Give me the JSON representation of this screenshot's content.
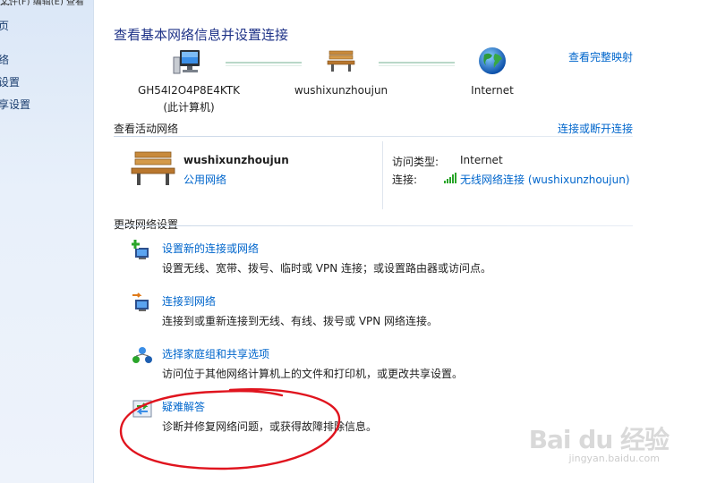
{
  "sidebar": {
    "top_text": "文件(F) 编辑(E) 查看(V)",
    "items": [
      {
        "label": "页"
      },
      {
        "label": "络"
      },
      {
        "label": "设置"
      },
      {
        "label": "享设置"
      }
    ]
  },
  "page": {
    "title": "查看基本网络信息并设置连接",
    "full_map_link": "查看完整映射"
  },
  "network_map": {
    "computer_name": "GH54I2O4P8E4KTK",
    "computer_sub": "(此计算机)",
    "network_name": "wushixunzhoujun",
    "internet_label": "Internet"
  },
  "active": {
    "heading": "查看活动网络",
    "connect_link": "连接或断开连接",
    "network_name": "wushixunzhoujun",
    "network_type": "公用网络",
    "access_type_label": "访问类型:",
    "access_type_value": "Internet",
    "connection_label": "连接:",
    "connection_value": "无线网络连接 (wushixunzhoujun)"
  },
  "change": {
    "heading": "更改网络设置",
    "tasks": [
      {
        "link": "设置新的连接或网络",
        "desc": "设置无线、宽带、拨号、临时或 VPN 连接；或设置路由器或访问点。"
      },
      {
        "link": "连接到网络",
        "desc": "连接到或重新连接到无线、有线、拨号或 VPN 网络连接。"
      },
      {
        "link": "选择家庭组和共享选项",
        "desc": "访问位于其他网络计算机上的文件和打印机，或更改共享设置。"
      },
      {
        "link": "疑难解答",
        "desc": "诊断并修复网络问题，或获得故障排除信息。"
      }
    ]
  },
  "watermark": {
    "text": "Bai du 经验",
    "sub": "jingyan.baidu.com"
  },
  "colors": {
    "link": "#0066cc",
    "title": "#1e3287",
    "annotation": "#e0141e"
  }
}
